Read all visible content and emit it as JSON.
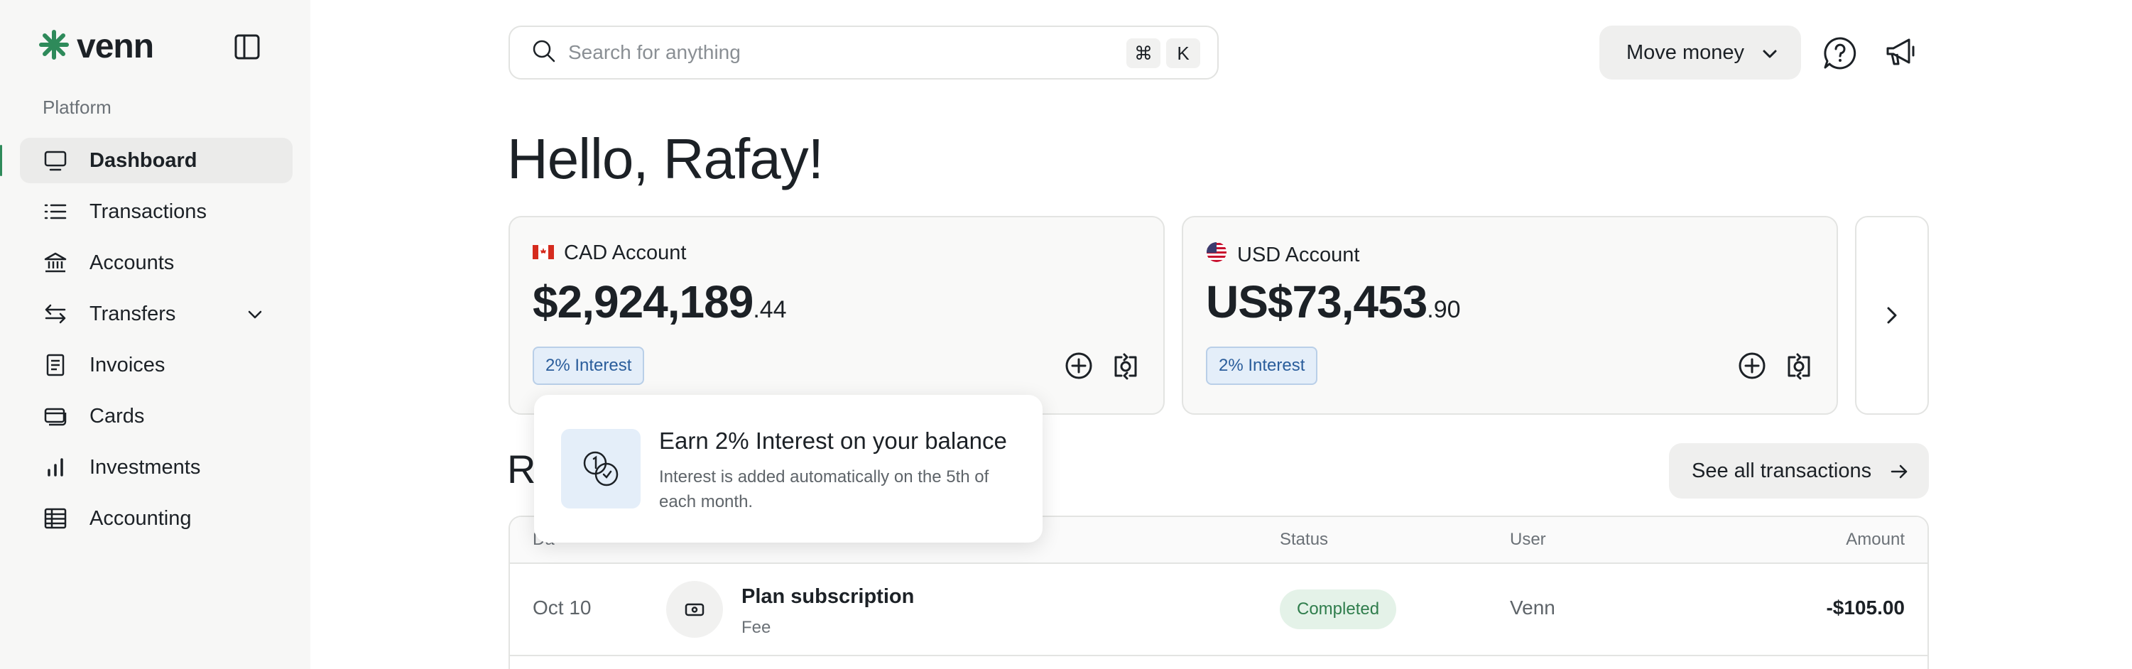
{
  "app": {
    "logo_text": "venn"
  },
  "sidebar": {
    "section_label": "Platform",
    "items": [
      {
        "label": "Dashboard",
        "icon": "monitor-icon",
        "active": true
      },
      {
        "label": "Transactions",
        "icon": "list-icon"
      },
      {
        "label": "Accounts",
        "icon": "bank-icon"
      },
      {
        "label": "Transfers",
        "icon": "arrows-swap-icon",
        "has_submenu": true
      },
      {
        "label": "Invoices",
        "icon": "document-icon"
      },
      {
        "label": "Cards",
        "icon": "cards-icon"
      },
      {
        "label": "Investments",
        "icon": "bar-chart-icon"
      },
      {
        "label": "Accounting",
        "icon": "table-icon"
      }
    ]
  },
  "header": {
    "search_placeholder": "Search for anything",
    "shortcut_keys": [
      "⌘",
      "K"
    ],
    "move_money_label": "Move money"
  },
  "greeting": "Hello, Rafay!",
  "accounts": [
    {
      "name": "CAD Account",
      "flag": "canada-flag-icon",
      "balance_main": "$2,924,189",
      "balance_cents": ".44",
      "badge": "2% Interest"
    },
    {
      "name": "USD Account",
      "flag": "us-flag-icon",
      "balance_main": "US$73,453",
      "balance_cents": ".90",
      "badge": "2% Interest"
    }
  ],
  "recent": {
    "title_visible": "R",
    "see_all_label": "See all transactions",
    "columns": {
      "date": "Da",
      "status": "Status",
      "user": "User",
      "amount": "Amount"
    },
    "rows": [
      {
        "date": "Oct 10",
        "name": "Plan subscription",
        "type": "Fee",
        "status": "Completed",
        "user": "Venn",
        "amount": "-$105.00"
      }
    ]
  },
  "popover": {
    "title": "Earn 2% Interest on your balance",
    "body": "Interest is added automatically on the 5th of each month."
  },
  "colors": {
    "brand_green": "#2e8a5a",
    "interest_blue": "#2a5d9b",
    "status_green": "#2f7d4c"
  }
}
